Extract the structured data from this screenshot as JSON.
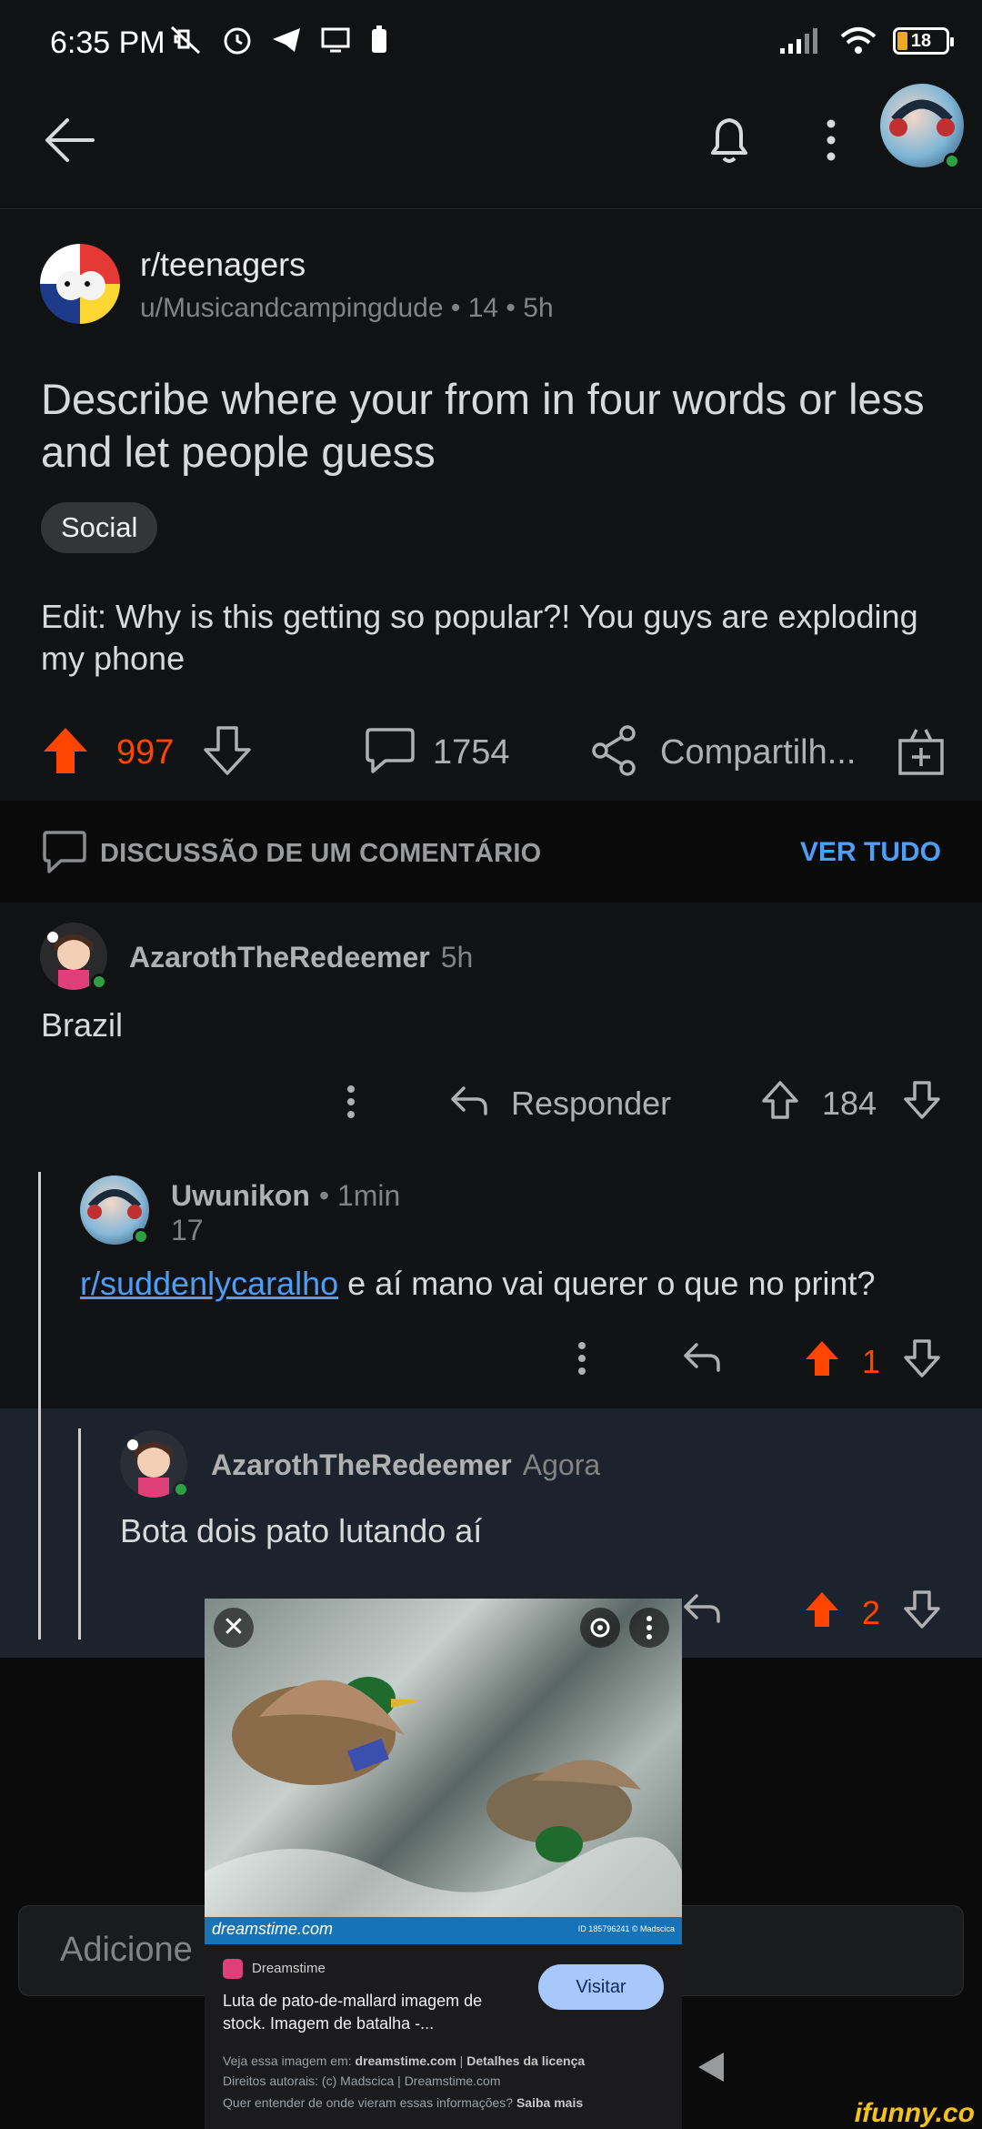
{
  "status_bar": {
    "time": "6:35 PM",
    "battery": "18"
  },
  "post": {
    "subreddit": "r/teenagers",
    "meta": "u/Musicandcampingdude • 14 • 5h",
    "title": "Describe where your from in four words or less and let people guess",
    "flair": "Social",
    "body": "Edit: Why is this getting so popular?! You guys are exploding my phone",
    "upvotes": "997",
    "comments": "1754",
    "share_label": "Compartilh..."
  },
  "thread": {
    "title": "DISCUSSÃO DE UM COMENTÁRIO",
    "see_all": "VER TUDO"
  },
  "comments": [
    {
      "author": "AzarothTheRedeemer",
      "time": "5h",
      "text": "Brazil",
      "reply_label": "Responder",
      "score": "184"
    },
    {
      "author": "Uwunikon",
      "time": "• 1min",
      "flair_num": "17",
      "link": "r/suddenlycaralho",
      "text": " e aí mano vai querer o que no print?",
      "score": "1"
    },
    {
      "author": "AzarothTheRedeemer",
      "time": "Agora",
      "text": "Bota dois pato lutando aí",
      "score": "2"
    }
  ],
  "input": {
    "placeholder": "Adicione"
  },
  "popup": {
    "watermark": "dreamstime.com",
    "id_text": "ID 185796241 © Madscica",
    "source": "Dreamstime",
    "title": "Luta de pato-de-mallard imagem de stock. Imagem de batalha -...",
    "visit": "Visitar",
    "line1_a": "Veja essa imagem em: ",
    "line1_b": "dreamstime.com",
    "line1_c": " | ",
    "line1_d": "Detalhes da licença",
    "line2": "Direitos autorais: (c) Madscica | Dreamstime.com",
    "line3_a": "Quer entender de onde vieram essas informações? ",
    "line3_b": "Saiba mais"
  },
  "watermark": "ifunny.co",
  "colors": {
    "upvote": "#ff4500",
    "link": "#4d9ef7",
    "highlight": "#1d232c"
  }
}
